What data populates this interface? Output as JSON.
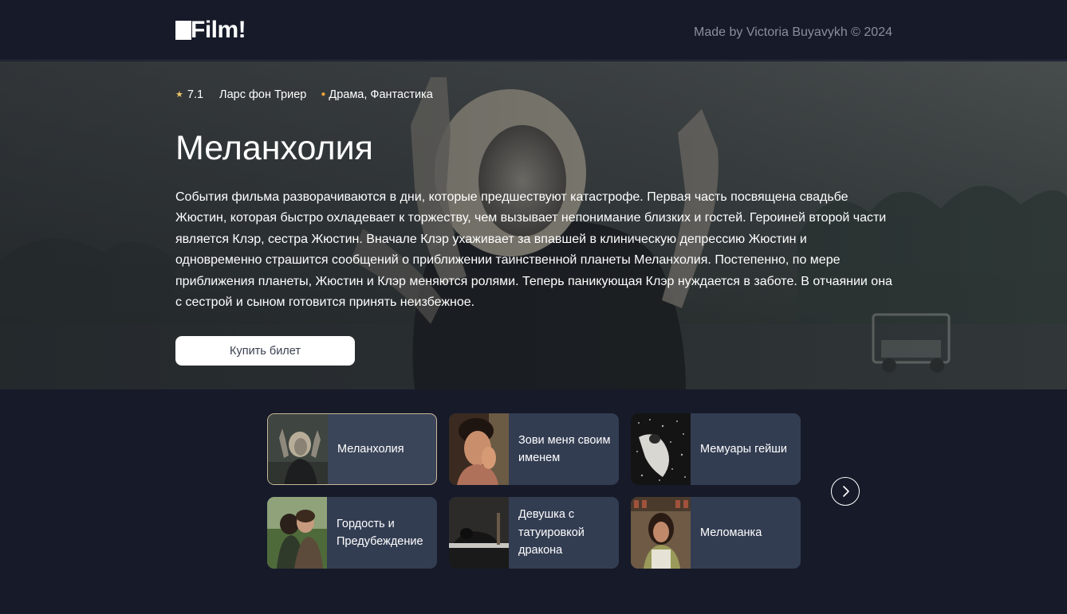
{
  "header": {
    "logo_text": "Film!",
    "credits": "Made by Victoria Buyavykh © 2024"
  },
  "hero": {
    "rating": "7.1",
    "director": "Ларс фон Триер",
    "genres": "Драма, Фантастика",
    "title": "Меланхолия",
    "description": "События фильма разворачиваются в дни, которые предшествуют катастрофе. Первая часть посвящена свадьбе Жюстин, которая быстро охладевает к торжеству, чем вызывает непонимание близких и гостей. Героиней второй части является Клэр, сестра Жюстин. Вначале Клэр ухаживает за впавшей в клиническую депрессию Жюстин и одновременно страшится сообщений о приближении таинственной планеты Меланхолия. Постепенно, по мере приближения планеты, Жюстин и Клэр меняются ролями. Теперь паникующая Клэр нуждается в заботе. В отчаянии она с сестрой и сыном готовится принять неизбежное.",
    "buy_label": "Купить билет"
  },
  "cards": [
    {
      "title": "Меланхолия",
      "active": true
    },
    {
      "title": "Зови меня своим именем",
      "active": false
    },
    {
      "title": "Мемуары гейши",
      "active": false
    },
    {
      "title": "Гордость и Предубеждение",
      "active": false
    },
    {
      "title": "Девушка с татуировкой дракона",
      "active": false
    },
    {
      "title": "Меломанка",
      "active": false
    }
  ],
  "icons": {
    "star": "star-icon",
    "next": "chevron-right-icon"
  },
  "colors": {
    "background": "#161a29",
    "card": "#333d52",
    "accent_star": "#e9c46a",
    "accent_dot": "#e9a23b",
    "active_border": "#c9b89a"
  }
}
